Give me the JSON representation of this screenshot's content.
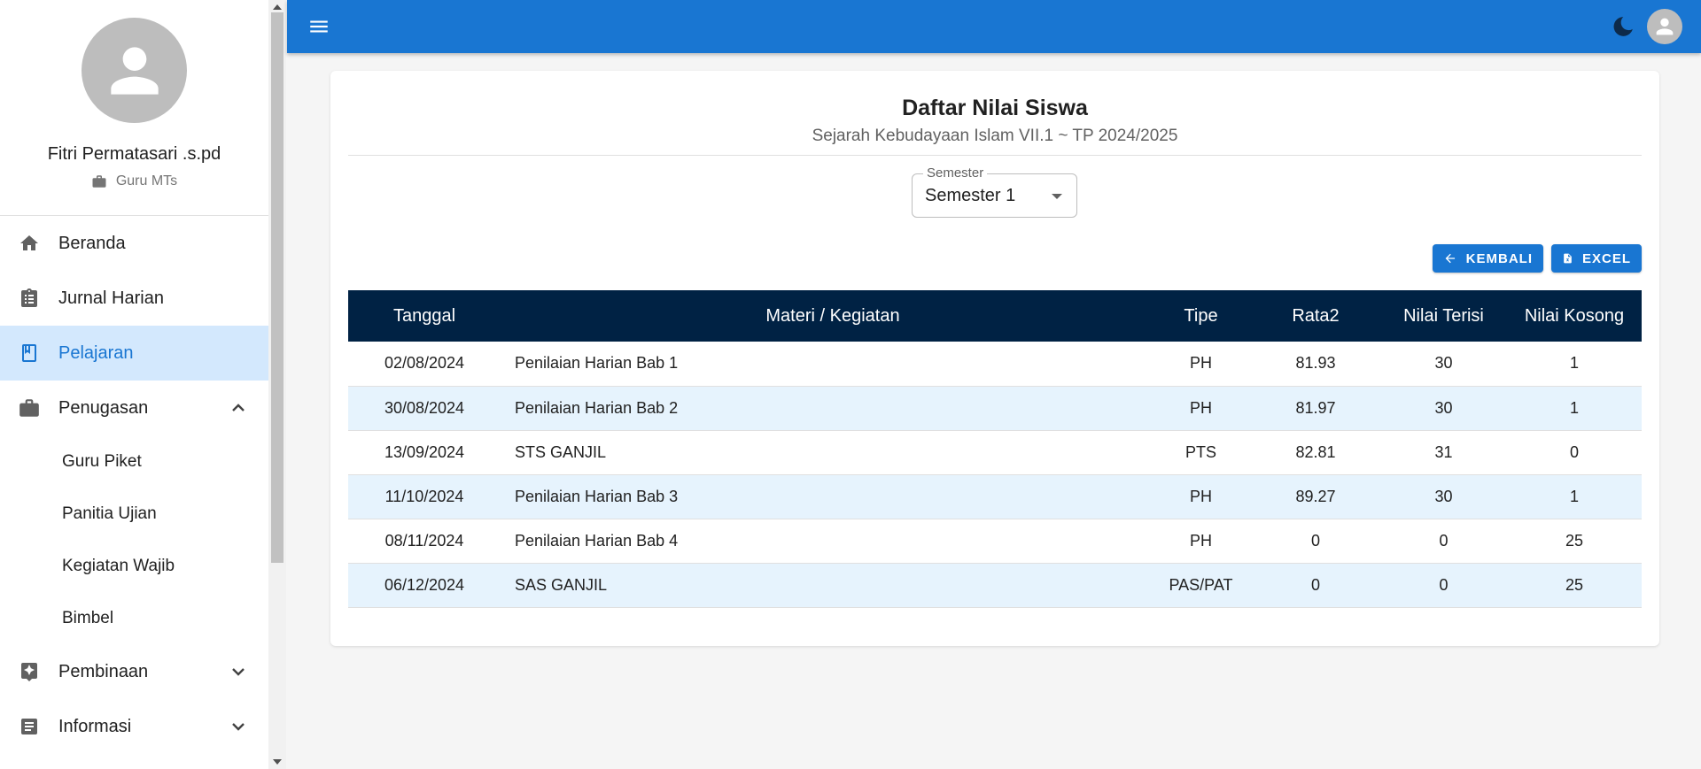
{
  "profile": {
    "name": "Fitri Permatasari .s.pd",
    "role": "Guru MTs"
  },
  "sidebar": {
    "items": [
      {
        "label": "Beranda",
        "icon": "home-icon"
      },
      {
        "label": "Jurnal Harian",
        "icon": "clipboard-icon"
      },
      {
        "label": "Pelajaran",
        "icon": "book-icon",
        "active": true
      },
      {
        "label": "Penugasan",
        "icon": "briefcase-icon",
        "expanded": true
      },
      {
        "label": "Pembinaan",
        "icon": "star-box-icon",
        "expanded": false
      },
      {
        "label": "Informasi",
        "icon": "article-icon",
        "expanded": false
      }
    ],
    "sub_items": [
      "Guru Piket",
      "Panitia Ujian",
      "Kegiatan Wajib",
      "Bimbel"
    ]
  },
  "header": {
    "menu_icon": "menu-icon",
    "theme_icon": "moon-icon",
    "avatar_icon": "user-avatar-icon"
  },
  "page": {
    "title": "Daftar Nilai Siswa",
    "subtitle": "Sejarah Kebudayaan Islam VII.1 ~ TP 2024/2025"
  },
  "semester": {
    "label": "Semester",
    "value": "Semester 1"
  },
  "buttons": {
    "back": "KEMBALI",
    "excel": "EXCEL"
  },
  "table": {
    "headers": [
      "Tanggal",
      "Materi / Kegiatan",
      "Tipe",
      "Rata2",
      "Nilai Terisi",
      "Nilai Kosong"
    ],
    "rows": [
      [
        "02/08/2024",
        "Penilaian Harian Bab 1",
        "PH",
        "81.93",
        "30",
        "1"
      ],
      [
        "30/08/2024",
        "Penilaian Harian Bab 2",
        "PH",
        "81.97",
        "30",
        "1"
      ],
      [
        "13/09/2024",
        "STS GANJIL",
        "PTS",
        "82.81",
        "31",
        "0"
      ],
      [
        "11/10/2024",
        "Penilaian Harian Bab 3",
        "PH",
        "89.27",
        "30",
        "1"
      ],
      [
        "08/11/2024",
        "Penilaian Harian Bab 4",
        "PH",
        "0",
        "0",
        "25"
      ],
      [
        "06/12/2024",
        "SAS GANJIL",
        "PAS/PAT",
        "0",
        "0",
        "25"
      ]
    ]
  },
  "colors": {
    "primary": "#1976d2",
    "table_header": "#002244",
    "row_stripe": "#e6f3fd",
    "active_nav_bg": "#d3e8fd"
  }
}
